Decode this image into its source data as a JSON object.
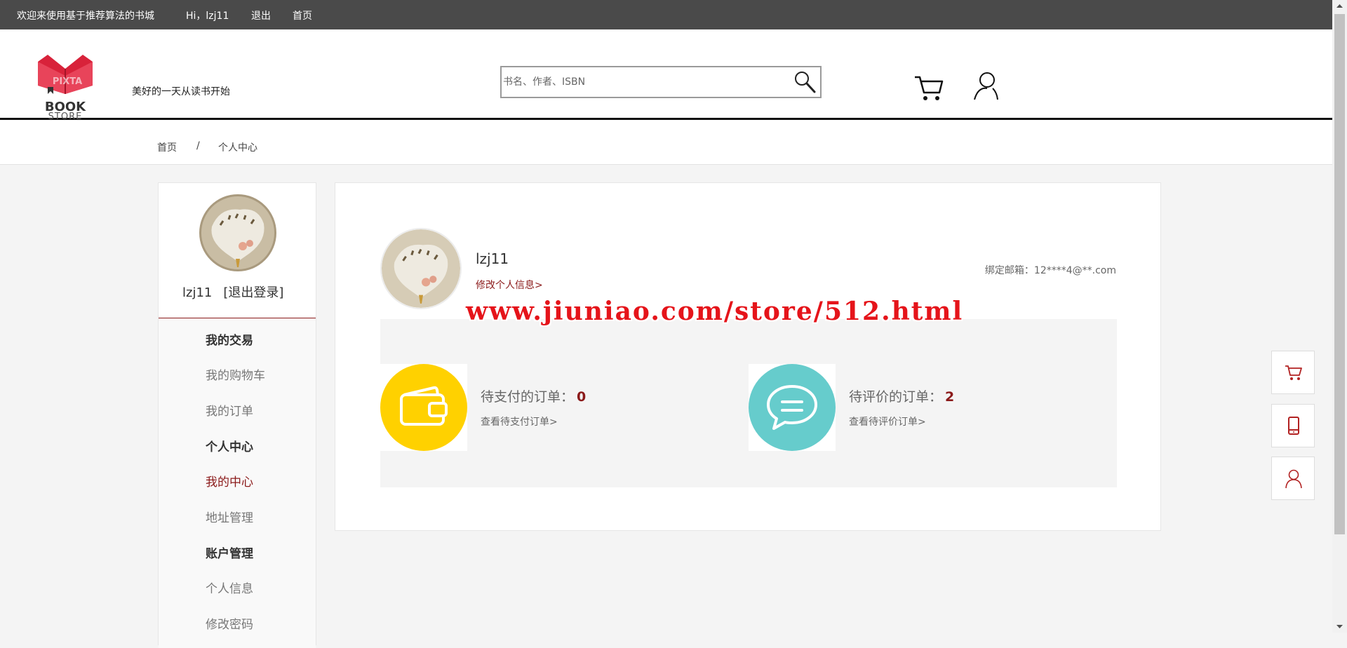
{
  "topbar": {
    "welcome": "欢迎来使用基于推荐算法的书城",
    "greeting": "Hi，lzj11",
    "logout": "退出",
    "home": "首页"
  },
  "header": {
    "logo_text_main": "BOOK",
    "logo_text_sub": "STORE",
    "logo_watermark": "PIXTA",
    "slogan": "美好的一天从读书开始",
    "search_placeholder": "书名、作者、ISBN"
  },
  "breadcrumb": {
    "home": "首页",
    "separator": "/",
    "current": "个人中心"
  },
  "sidebar": {
    "username": "lzj11",
    "logout": "[退出登录]",
    "sections": [
      {
        "title": "我的交易",
        "items": [
          "我的购物车",
          "我的订单"
        ]
      },
      {
        "title": "个人中心",
        "items": [
          "我的中心",
          "地址管理"
        ]
      },
      {
        "title": "账户管理",
        "items": [
          "个人信息",
          "修改密码"
        ]
      }
    ],
    "active_item": "我的中心"
  },
  "profile": {
    "name": "lzj11",
    "edit_link": "修改个人信息>",
    "email_label": "绑定邮箱：",
    "email": "12****4@**.com"
  },
  "orders": {
    "pending_pay_label": "待支付的订单：",
    "pending_pay_count": "0",
    "pending_pay_link": "查看待支付订单>",
    "pending_review_label": "待评价的订单：",
    "pending_review_count": "2",
    "pending_review_link": "查看待评价订单>"
  },
  "watermark": "www.jiuniao.com/store/512.html",
  "colors": {
    "accent": "#8b1a1a",
    "topbar_bg": "#4a4a4a",
    "wallet_yellow": "#ffd100",
    "chat_teal": "#66cccc"
  },
  "icons": {
    "search": "search-icon",
    "cart": "cart-icon",
    "user": "user-icon",
    "phone": "phone-icon",
    "wallet": "wallet-icon",
    "chat": "chat-icon"
  }
}
